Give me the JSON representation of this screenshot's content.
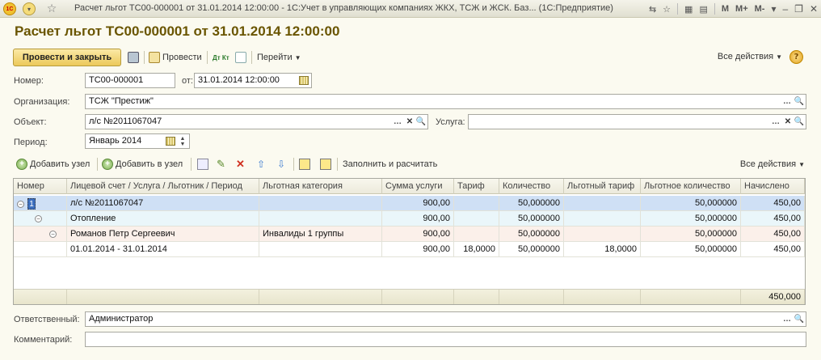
{
  "window": {
    "title": "Расчет льгот ТС00-000001 от 31.01.2014 12:00:00 - 1С:Учет в управляющих компаниях ЖКХ, ТСЖ и ЖСК. Баз...  (1С:Предприятие)",
    "logo": "1С",
    "buttons": [
      "M",
      "M+",
      "M-"
    ]
  },
  "document": {
    "heading": "Расчет льгот ТС00-000001 от 31.01.2014 12:00:00"
  },
  "toolbar": {
    "post_close": "Провести и закрыть",
    "post": "Провести",
    "dt_kt": "Дт Кт",
    "goto": "Перейти",
    "all_actions": "Все действия",
    "help": "?"
  },
  "form": {
    "number_label": "Номер:",
    "number_value": "ТС00-000001",
    "from_label": "от:",
    "date_value": "31.01.2014 12:00:00",
    "org_label": "Организация:",
    "org_value": "ТСЖ \"Престиж\"",
    "object_label": "Объект:",
    "object_value": "л/с №2011067047",
    "service_label": "Услуга:",
    "service_value": "",
    "period_label": "Период:",
    "period_value": "Январь 2014",
    "responsible_label": "Ответственный:",
    "responsible_value": "Администратор",
    "comment_label": "Комментарий:",
    "comment_value": ""
  },
  "table_toolbar": {
    "add_node": "Добавить узел",
    "add_to_node": "Добавить в узел",
    "fill_calc": "Заполнить и расчитать",
    "all_actions": "Все действия"
  },
  "table": {
    "columns": [
      "Номер",
      "Лицевой счет / Услуга / Льготник / Период",
      "Льготная категория",
      "Сумма услуги",
      "Тариф",
      "Количество",
      "Льготный тариф",
      "Льготное количество",
      "Начислено"
    ],
    "rows": [
      {
        "num": "1",
        "name": "л/с №2011067047",
        "category": "",
        "sum": "900,00",
        "tariff": "",
        "qty": "50,000000",
        "ben_tariff": "",
        "ben_qty": "50,000000",
        "accrued": "450,00"
      },
      {
        "num": "",
        "name": "Отопление",
        "category": "",
        "sum": "900,00",
        "tariff": "",
        "qty": "50,000000",
        "ben_tariff": "",
        "ben_qty": "50,000000",
        "accrued": "450,00"
      },
      {
        "num": "",
        "name": "Романов Петр Сергеевич",
        "category": "Инвалиды 1 группы",
        "sum": "900,00",
        "tariff": "",
        "qty": "50,000000",
        "ben_tariff": "",
        "ben_qty": "50,000000",
        "accrued": "450,00"
      },
      {
        "num": "",
        "name": "01.01.2014 - 31.01.2014",
        "category": "",
        "sum": "900,00",
        "tariff": "18,0000",
        "qty": "50,000000",
        "ben_tariff": "18,0000",
        "ben_qty": "50,000000",
        "accrued": "450,00"
      }
    ],
    "total_accrued": "450,000"
  },
  "colors": {
    "accent": "#ecc95a",
    "heading": "#6a5500",
    "selected_row": "#cfe0f5"
  }
}
